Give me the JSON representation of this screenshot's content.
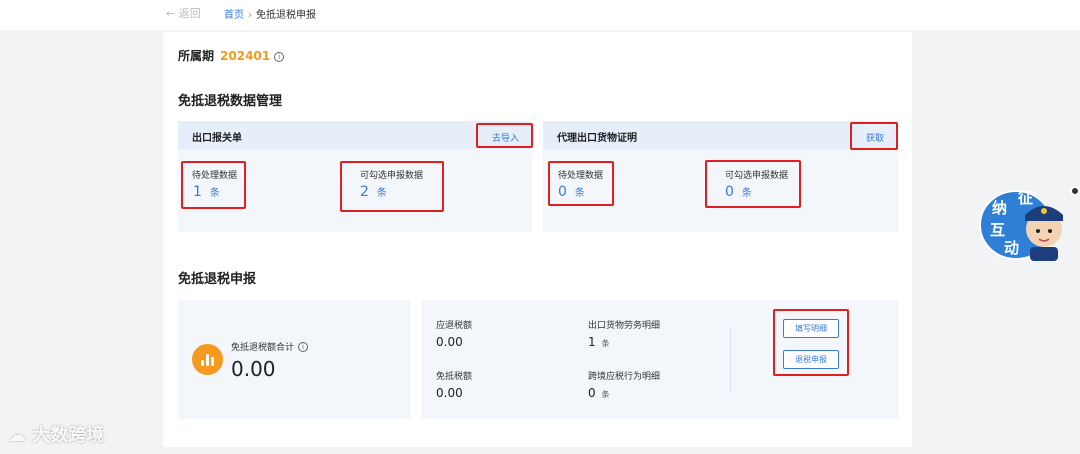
{
  "nav": {
    "back_label": "← 返回",
    "breadcrumb_home": "首页",
    "breadcrumb_sep": "›",
    "breadcrumb_current": "免抵退税申报"
  },
  "period": {
    "label": "所属期",
    "value": "202401",
    "info_glyph": "i"
  },
  "data_mgmt": {
    "title": "免抵退税数据管理",
    "customs": {
      "title": "出口报关单",
      "action": "去导入",
      "pending_label": "待处理数据",
      "pending_value": "1",
      "pending_unit": "条",
      "selectable_label": "可勾选申报数据",
      "selectable_value": "2",
      "selectable_unit": "条"
    },
    "agency": {
      "title": "代理出口货物证明",
      "action": "获取",
      "pending_label": "待处理数据",
      "pending_value": "0",
      "pending_unit": "条",
      "selectable_label": "可勾选申报数据",
      "selectable_value": "0",
      "selectable_unit": "条"
    }
  },
  "declare": {
    "title": "免抵退税申报",
    "total_label": "免抵退税额合计",
    "total_value": "0.00",
    "refund_label": "应退税额",
    "refund_value": "0.00",
    "exempt_label": "免抵税额",
    "exempt_value": "0.00",
    "export_detail_label": "出口货物劳务明细",
    "export_detail_value": "1",
    "export_detail_unit": "条",
    "crossborder_label": "跨境应税行为明细",
    "crossborder_value": "0",
    "crossborder_unit": "条",
    "fill_button": "填写明细",
    "submit_button": "退税申报"
  },
  "mascot": {
    "text_1": "征",
    "text_2": "纳",
    "text_3": "互",
    "text_4": "动"
  },
  "watermark": "大数跨境",
  "colors": {
    "accent": "#3a7ad9",
    "period": "#f09b1e",
    "highlight": "#e02020",
    "icon_bg": "#f59a1e"
  }
}
